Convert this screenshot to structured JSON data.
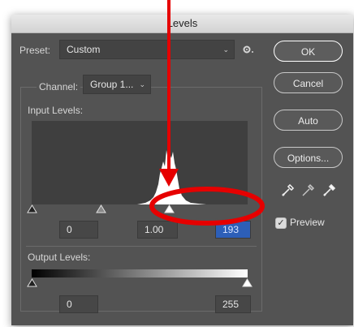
{
  "dialog": {
    "title": "Levels"
  },
  "preset": {
    "label": "Preset:",
    "value": "Custom"
  },
  "channel": {
    "label": "Channel:",
    "value": "Group 1..."
  },
  "input_levels": {
    "label": "Input Levels:",
    "black_value": "0",
    "gamma_value": "1.00",
    "white_value": "193"
  },
  "output_levels": {
    "label": "Output Levels:",
    "black_value": "0",
    "white_value": "255"
  },
  "buttons": {
    "ok": "OK",
    "cancel": "Cancel",
    "auto": "Auto",
    "options": "Options..."
  },
  "preview": {
    "label": "Preview",
    "checked": true
  },
  "icons": {
    "preset_menu": "gear-icon",
    "dropdown": "chevron-down-icon",
    "eyedroppers": [
      "black-eyedropper-icon",
      "gray-eyedropper-icon",
      "white-eyedropper-icon"
    ]
  },
  "colors": {
    "panel": "#535353",
    "histogram_bg": "#3f3f3f",
    "annotation": "#e60000",
    "selection": "#2d5fb8"
  }
}
